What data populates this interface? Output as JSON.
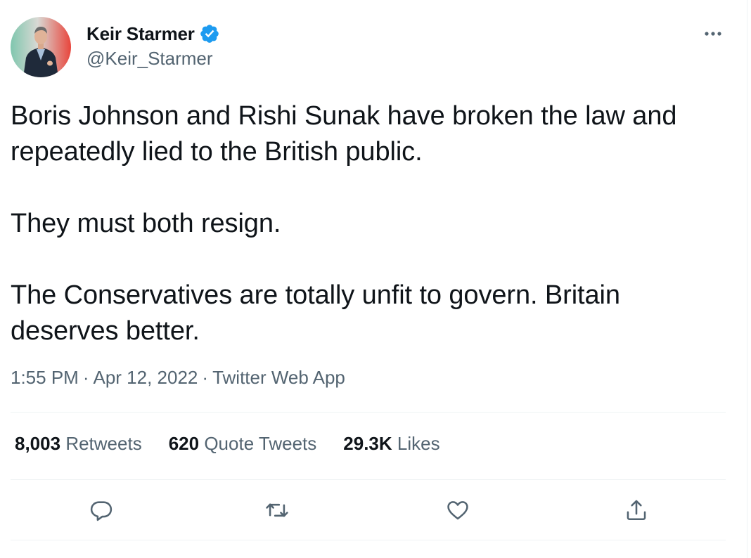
{
  "author": {
    "display_name": "Keir Starmer",
    "handle": "@Keir_Starmer",
    "verified": true,
    "avatar_icon": "profile-photo"
  },
  "more_icon": "more-horizontal-icon",
  "tweet": {
    "paragraphs": [
      "Boris Johnson and Rishi Sunak have broken the law and repeatedly lied to the British public.",
      "They must both resign.",
      "The Conservatives are totally unfit to govern. Britain deserves better."
    ]
  },
  "meta": {
    "time": "1:55 PM",
    "separator": "·",
    "date": "Apr 12, 2022",
    "source": "Twitter Web App"
  },
  "stats": {
    "retweets": {
      "count": "8,003",
      "label": "Retweets"
    },
    "quotes": {
      "count": "620",
      "label": "Quote Tweets"
    },
    "likes": {
      "count": "29.3K",
      "label": "Likes"
    }
  },
  "actions": [
    {
      "name": "reply",
      "icon": "reply-icon"
    },
    {
      "name": "retweet",
      "icon": "retweet-icon"
    },
    {
      "name": "like",
      "icon": "heart-icon"
    },
    {
      "name": "share",
      "icon": "share-icon"
    }
  ],
  "colors": {
    "text_primary": "#0f1419",
    "text_secondary": "#536471",
    "verified_blue": "#1d9bf0",
    "divider": "#eff3f4"
  }
}
